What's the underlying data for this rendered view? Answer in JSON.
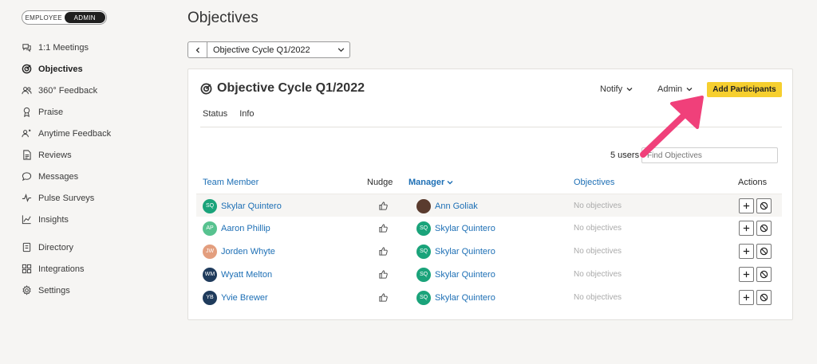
{
  "role_toggle": {
    "employee": "EMPLOYEE",
    "admin": "ADMIN",
    "active": "admin"
  },
  "sidebar": {
    "items": [
      {
        "label": "1:1 Meetings",
        "icon": "chat-bubbles-icon"
      },
      {
        "label": "Objectives",
        "icon": "target-icon",
        "active": true
      },
      {
        "label": "360° Feedback",
        "icon": "people-icon"
      },
      {
        "label": "Praise",
        "icon": "award-ribbon-icon"
      },
      {
        "label": "Anytime Feedback",
        "icon": "person-feedback-icon"
      },
      {
        "label": "Reviews",
        "icon": "document-icon"
      },
      {
        "label": "Messages",
        "icon": "message-bubble-icon"
      },
      {
        "label": "Pulse Surveys",
        "icon": "pulse-icon"
      },
      {
        "label": "Insights",
        "icon": "line-chart-icon"
      },
      {
        "label": "Directory",
        "icon": "directory-book-icon"
      },
      {
        "label": "Integrations",
        "icon": "grid-icon"
      },
      {
        "label": "Settings",
        "icon": "gear-icon"
      }
    ]
  },
  "page": {
    "title": "Objectives"
  },
  "cycle_selector": {
    "value": "Objective Cycle Q1/2022"
  },
  "card": {
    "title": "Objective Cycle Q1/2022",
    "notify_label": "Notify",
    "admin_label": "Admin",
    "add_participants_label": "Add Participants",
    "tabs": [
      "Status",
      "Info"
    ],
    "users_count": "5 users",
    "search_placeholder": "Find Objectives"
  },
  "table": {
    "headers": {
      "team_member": "Team Member",
      "nudge": "Nudge",
      "manager": "Manager",
      "objectives": "Objectives",
      "actions": "Actions"
    },
    "rows": [
      {
        "initials": "SQ",
        "member": "Skylar Quintero",
        "avatar_color": "#1aa37a",
        "manager": "Ann Goliak",
        "manager_initials": "",
        "manager_avatar_color": "#5a3b2e",
        "objectives": "No objectives"
      },
      {
        "initials": "AP",
        "member": "Aaron Phillip",
        "avatar_color": "#57c28f",
        "manager": "Skylar Quintero",
        "manager_initials": "SQ",
        "manager_avatar_color": "#1aa37a",
        "objectives": "No objectives"
      },
      {
        "initials": "JW",
        "member": "Jorden Whyte",
        "avatar_color": "#e39e7e",
        "manager": "Skylar Quintero",
        "manager_initials": "SQ",
        "manager_avatar_color": "#1aa37a",
        "objectives": "No objectives"
      },
      {
        "initials": "WM",
        "member": "Wyatt Melton",
        "avatar_color": "#1f3b5c",
        "manager": "Skylar Quintero",
        "manager_initials": "SQ",
        "manager_avatar_color": "#1aa37a",
        "objectives": "No objectives"
      },
      {
        "initials": "YB",
        "member": "Yvie Brewer",
        "avatar_color": "#1f3b5c",
        "manager": "Skylar Quintero",
        "manager_initials": "SQ",
        "manager_avatar_color": "#1aa37a",
        "objectives": "No objectives"
      }
    ]
  },
  "colors": {
    "accent": "#f6cf2f",
    "link": "#1d6fb5",
    "annotation_arrow": "#f0407a"
  }
}
